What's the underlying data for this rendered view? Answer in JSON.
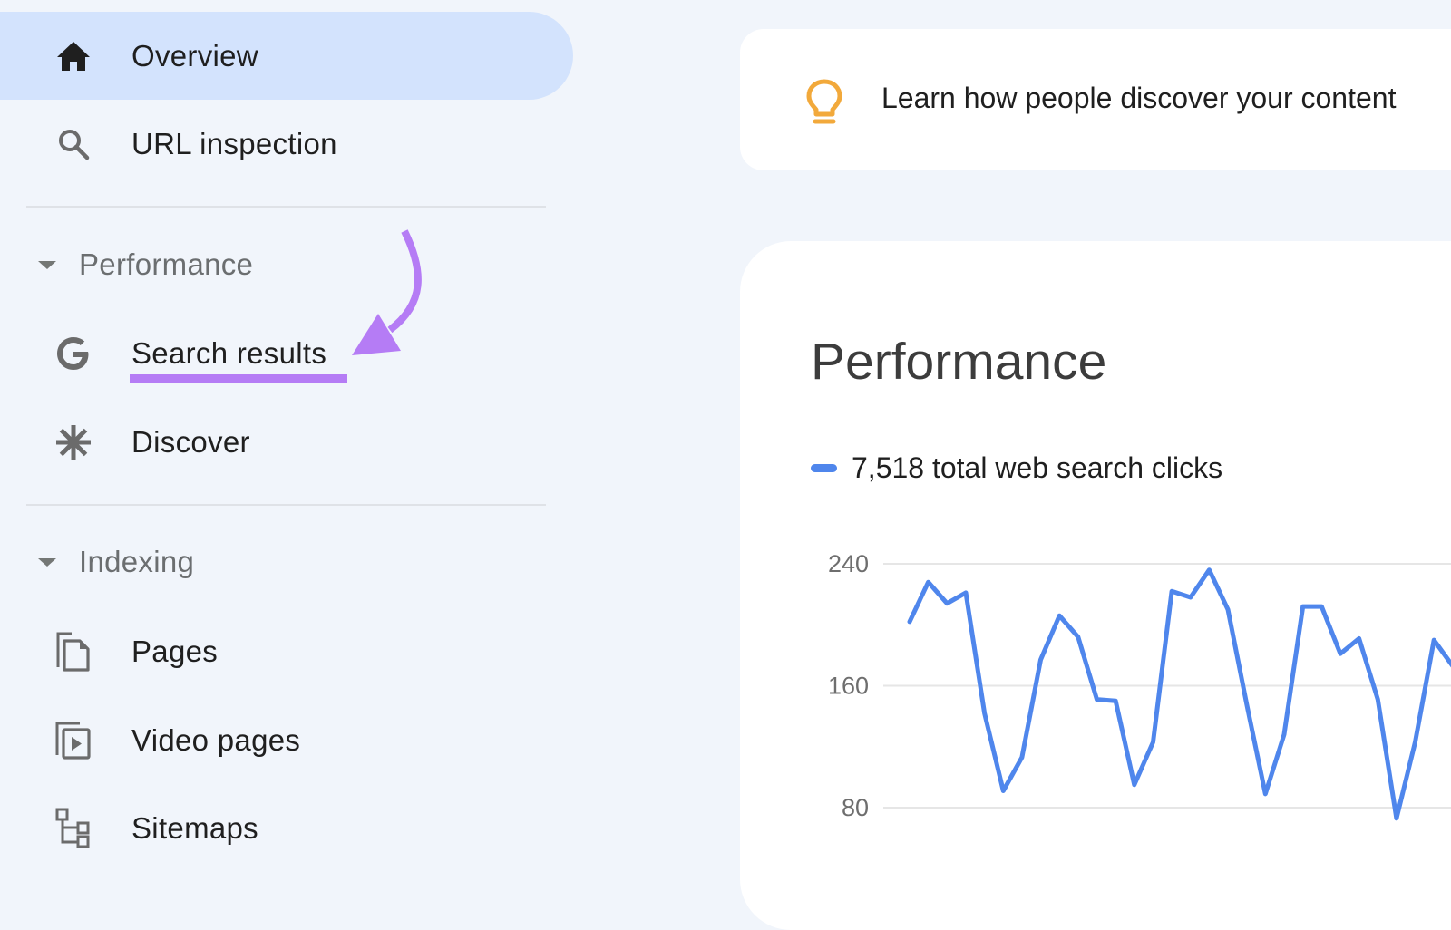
{
  "sidebar": {
    "items_top": [
      {
        "label": "Overview",
        "icon": "home-icon",
        "active": true
      },
      {
        "label": "URL inspection",
        "icon": "search-icon",
        "active": false
      }
    ],
    "sections": [
      {
        "label": "Performance",
        "expanded": true,
        "items": [
          {
            "label": "Search results",
            "icon": "google-g-icon",
            "highlighted": true
          },
          {
            "label": "Discover",
            "icon": "asterisk-icon"
          }
        ]
      },
      {
        "label": "Indexing",
        "expanded": true,
        "items": [
          {
            "label": "Pages",
            "icon": "pages-icon"
          },
          {
            "label": "Video pages",
            "icon": "video-pages-icon"
          },
          {
            "label": "Sitemaps",
            "icon": "sitemap-icon"
          }
        ]
      }
    ]
  },
  "annotation": {
    "color": "#b57cf5",
    "target": "Search results"
  },
  "banner": {
    "text": "Learn how people discover your content",
    "icon": "lightbulb-icon",
    "icon_color": "#f2a93b"
  },
  "performance": {
    "title": "Performance",
    "legend": "7,518 total web search clicks",
    "series_color": "#4f86ec"
  },
  "chart_data": {
    "type": "line",
    "title": "Performance",
    "xlabel": "",
    "ylabel": "",
    "yticks": [
      80,
      160,
      240
    ],
    "ytick_labels": [
      "80",
      "160",
      "240"
    ],
    "ylim": [
      80,
      240
    ],
    "grid": true,
    "legend": "top-left",
    "series": [
      {
        "name": "7,518 total web search clicks",
        "values": [
          202,
          228,
          214,
          221,
          142,
          91,
          113,
          177,
          206,
          192,
          151,
          150,
          95,
          123,
          222,
          218,
          236,
          210,
          148,
          89,
          128,
          212,
          212,
          181,
          191,
          151,
          73,
          123,
          190,
          173
        ]
      }
    ]
  }
}
